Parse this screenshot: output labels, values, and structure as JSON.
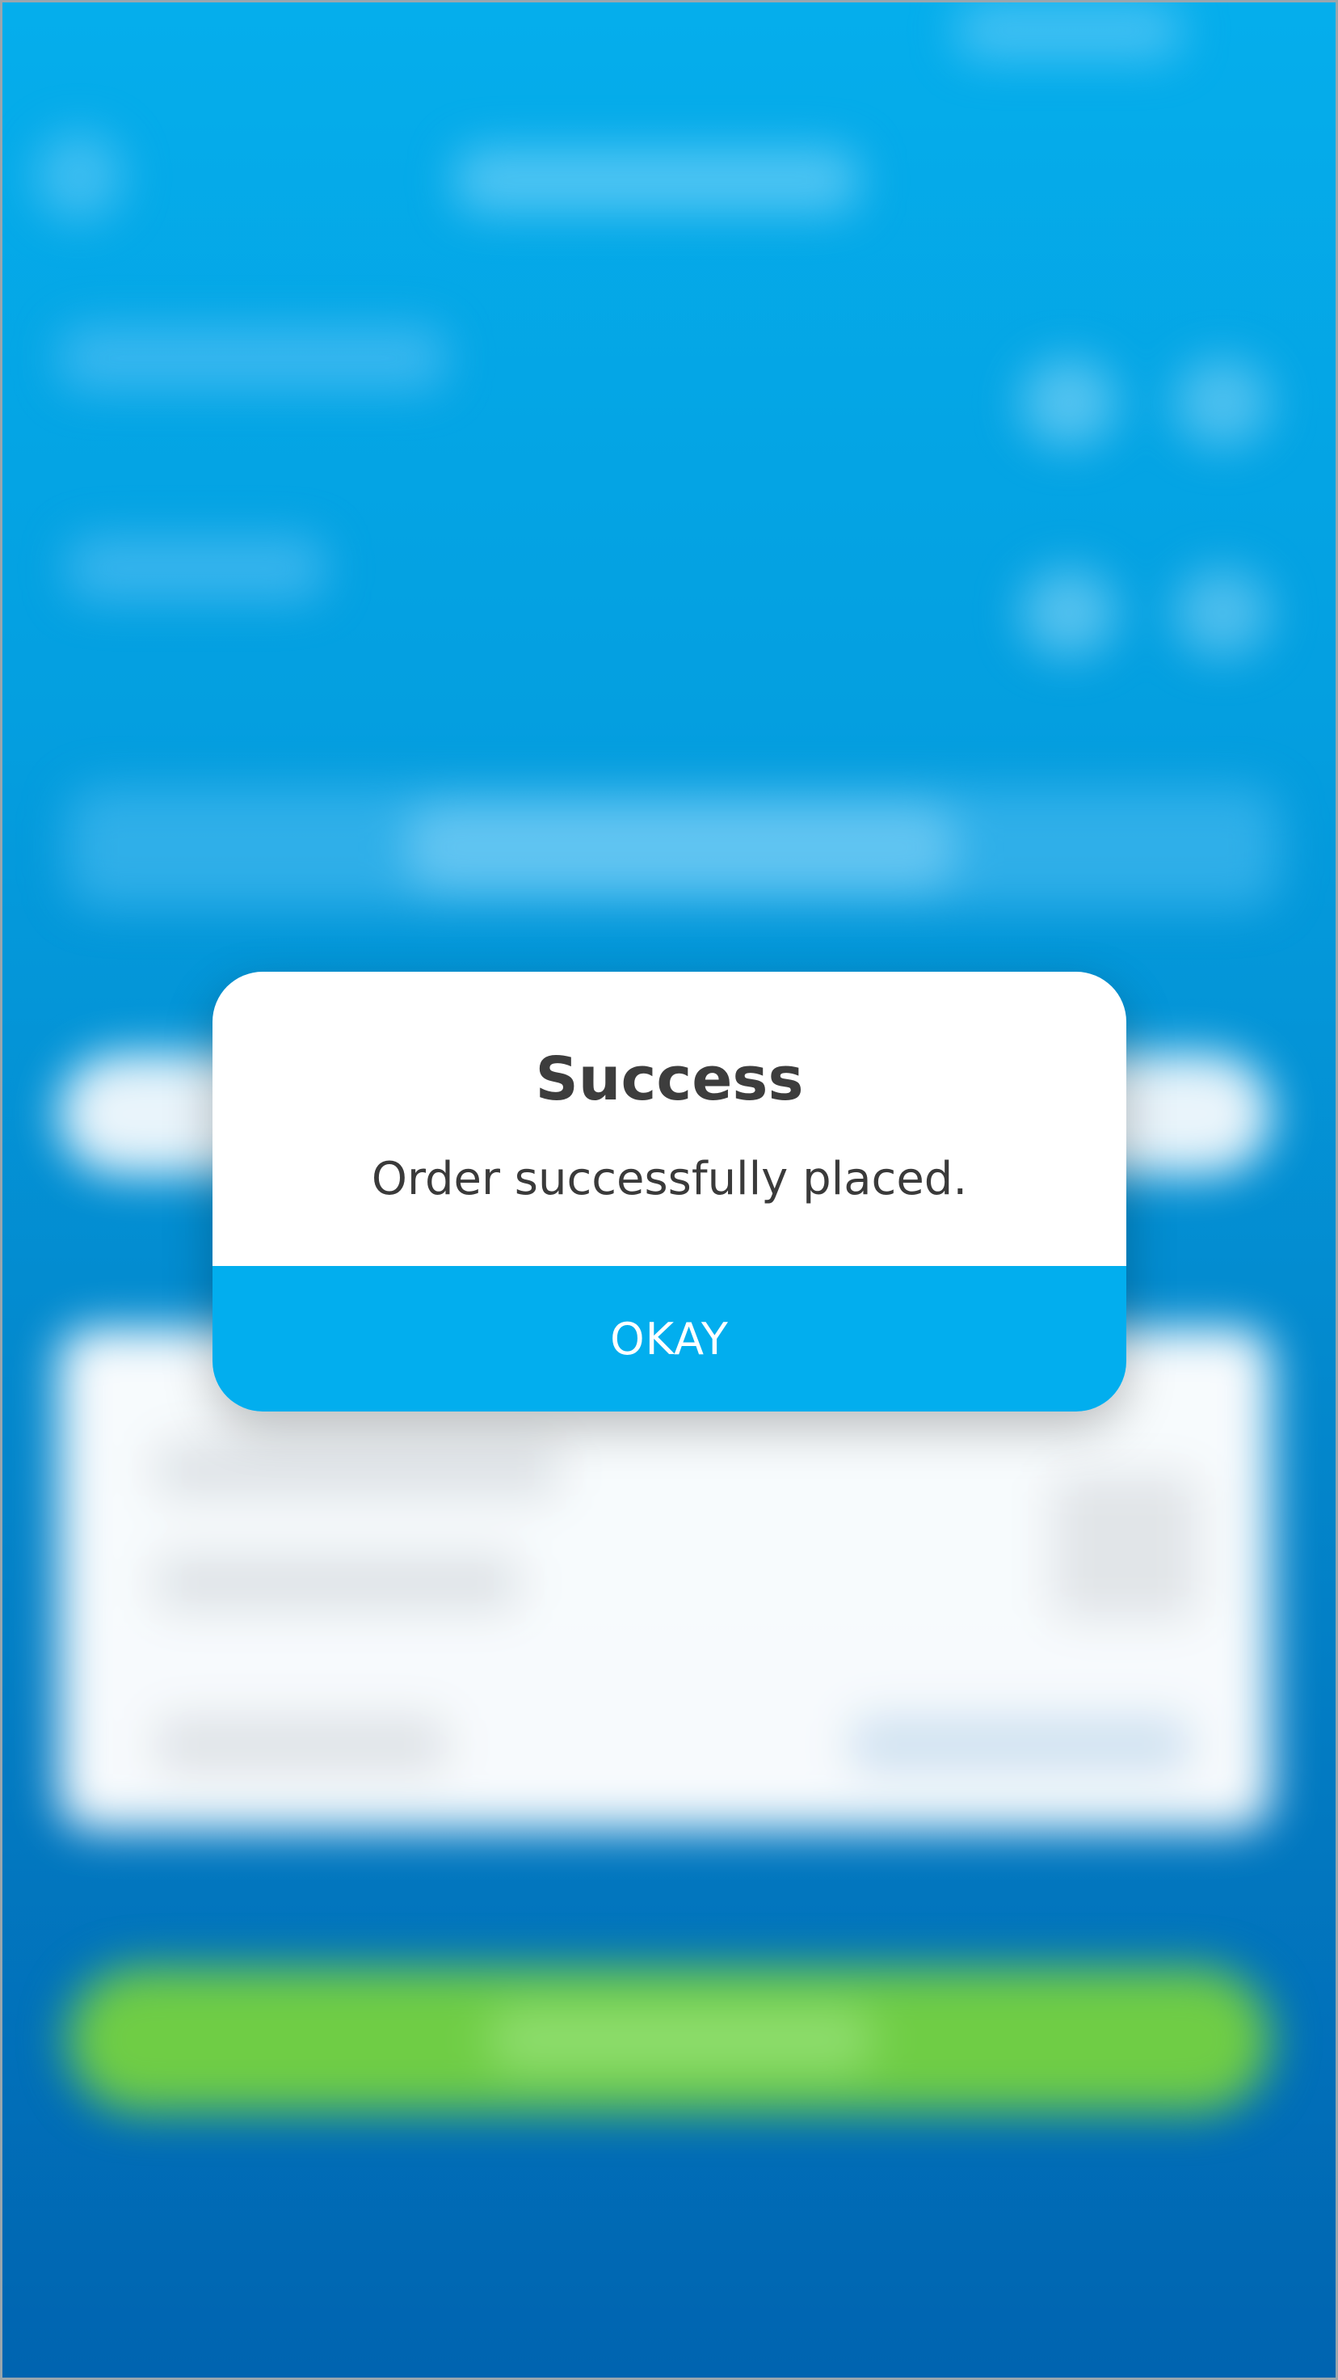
{
  "dialog": {
    "title": "Success",
    "message": "Order successfully placed.",
    "button_label": "OKAY"
  },
  "colors": {
    "primary_blue": "#02aeee",
    "background_top": "#05aeec",
    "background_bottom": "#0064b0",
    "success_green": "#6fcd45",
    "text_dark": "#3d3d3d"
  }
}
